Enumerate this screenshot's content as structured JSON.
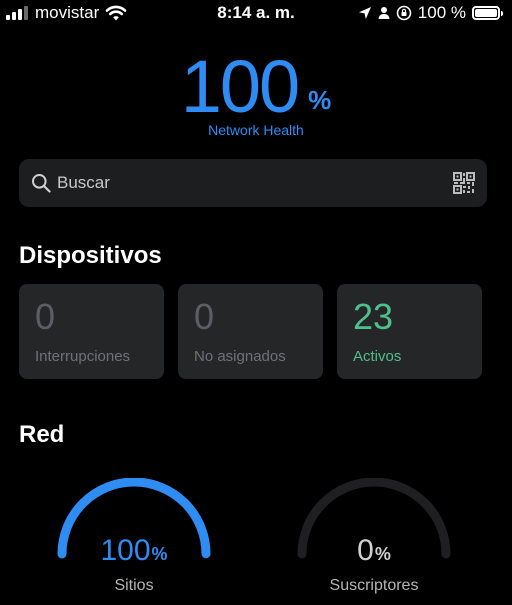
{
  "status_bar": {
    "carrier": "movistar",
    "time": "8:14 a. m.",
    "battery_percent": "100 %",
    "battery_level": 1.0,
    "signal_bars": 3
  },
  "health": {
    "value": "100",
    "unit": "%",
    "label": "Network Health"
  },
  "search": {
    "placeholder": "Buscar",
    "icon": "search-icon",
    "scan_icon": "qr-code-icon"
  },
  "devices": {
    "title": "Dispositivos",
    "cards": [
      {
        "value": "0",
        "label": "Interrupciones"
      },
      {
        "value": "0",
        "label": "No asignados"
      },
      {
        "value": "23",
        "label": "Activos"
      }
    ]
  },
  "network": {
    "title": "Red",
    "gauges": [
      {
        "value": "100",
        "unit": "%",
        "label": "Sitios",
        "fill": 1.0
      },
      {
        "value": "0",
        "unit": "%",
        "label": "Suscriptores",
        "fill": 0.0
      }
    ]
  },
  "colors": {
    "accent_blue": "#2e8cf3",
    "active_green": "#4fbf8c",
    "card_bg": "#252628",
    "search_bg": "#1d1e20",
    "gauge_track": "#1f1f21"
  }
}
